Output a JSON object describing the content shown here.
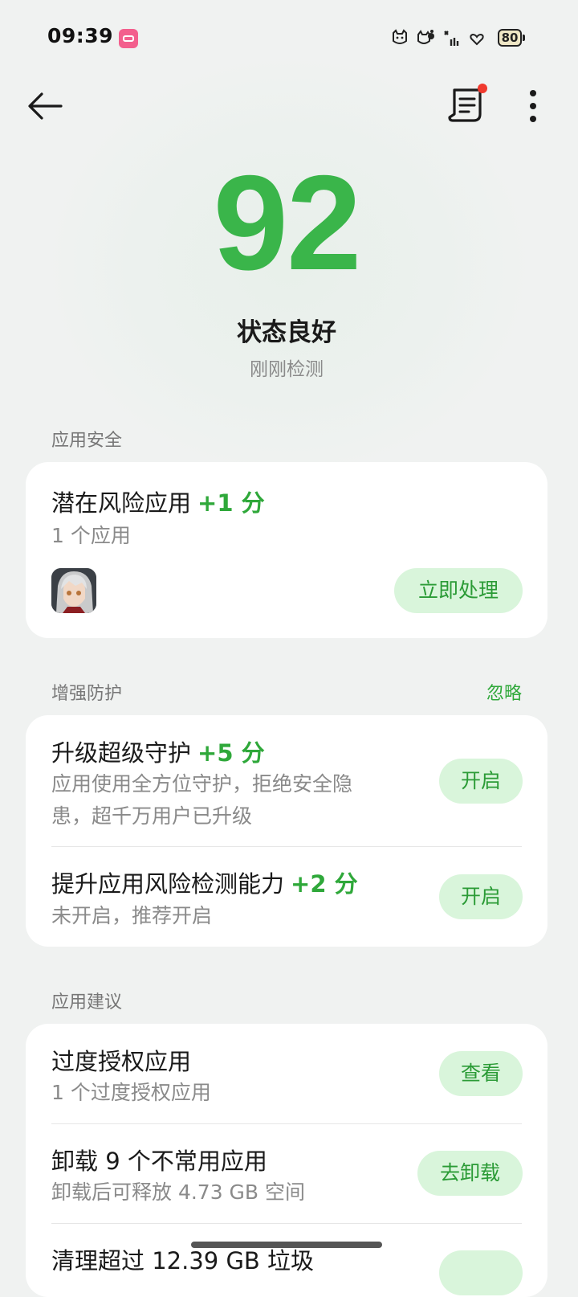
{
  "status_bar": {
    "time": "09:39",
    "battery": "80"
  },
  "score": {
    "value": "92",
    "status": "状态良好",
    "detected": "刚刚检测",
    "color": "#3ab54a"
  },
  "sections": {
    "app_security": {
      "title": "应用安全",
      "risk_apps": {
        "title": "潜在风险应用",
        "points": "+1 分",
        "count": "1 个应用",
        "button": "立即处理"
      }
    },
    "enhance": {
      "title": "增强防护",
      "ignore": "忽略",
      "items": [
        {
          "title": "升级超级守护",
          "points": "+5 分",
          "sub1": "应用使用全方位守护，拒绝安全隐",
          "sub2": "患，超千万用户已升级",
          "button": "开启"
        },
        {
          "title": "提升应用风险检测能力",
          "points": "+2 分",
          "sub1": "未开启，推荐开启",
          "button": "开启"
        }
      ]
    },
    "suggestions": {
      "title": "应用建议",
      "items": [
        {
          "title": "过度授权应用",
          "sub": "1 个过度授权应用",
          "button": "查看"
        },
        {
          "title": "卸载 9 个不常用应用",
          "sub": "卸载后可释放 4.73 GB 空间",
          "button": "去卸载"
        },
        {
          "title": "清理超过 12.39 GB 垃圾"
        }
      ]
    }
  },
  "colors": {
    "accent": "#2fa83a",
    "pill_bg": "#d9f5db",
    "badge_red": "#f03a2e"
  }
}
